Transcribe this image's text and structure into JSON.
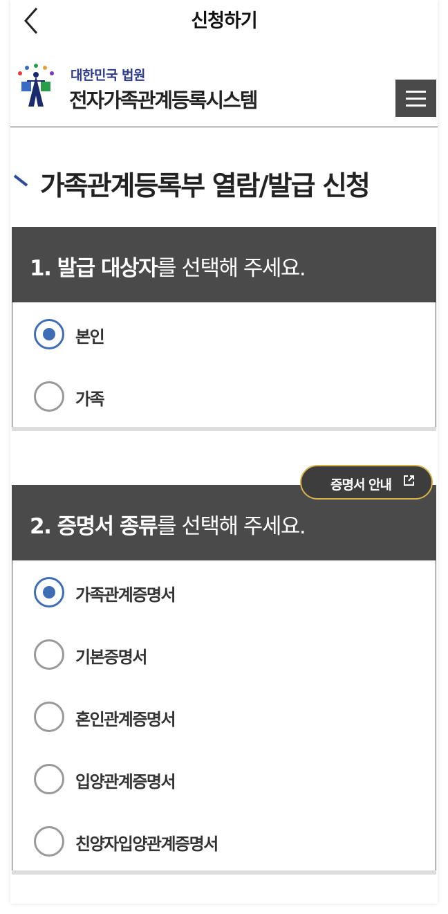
{
  "appbar": {
    "title": "신청하기",
    "back_icon": "chevron-left-icon"
  },
  "header": {
    "org_name": "대한민국 법원",
    "system_name": "전자가족관계등록시스템",
    "menu_icon": "hamburger-menu-icon"
  },
  "page_title": "가족관계등록부 열람/발급 신청",
  "section1": {
    "number": "1.",
    "bold_text": "발급 대상자",
    "rest_text": "를 선택해 주세요.",
    "options": [
      {
        "label": "본인",
        "checked": true
      },
      {
        "label": "가족",
        "checked": false
      }
    ]
  },
  "guide_button": {
    "label": "증명서 안내",
    "icon": "external-link-icon"
  },
  "section2": {
    "number": "2.",
    "bold_text": "증명서 종류",
    "rest_text": "를 선택해 주세요.",
    "options": [
      {
        "label": "가족관계증명서",
        "checked": true
      },
      {
        "label": "기본증명서",
        "checked": false
      },
      {
        "label": "혼인관계증명서",
        "checked": false
      },
      {
        "label": "입양관계증명서",
        "checked": false
      },
      {
        "label": "친양자입양관계증명서",
        "checked": false
      }
    ]
  },
  "colors": {
    "accent": "#3f6db5",
    "header_bg": "#4a4a4a",
    "brand_text": "#2b3a8c",
    "guide_border": "#d9b24c"
  }
}
